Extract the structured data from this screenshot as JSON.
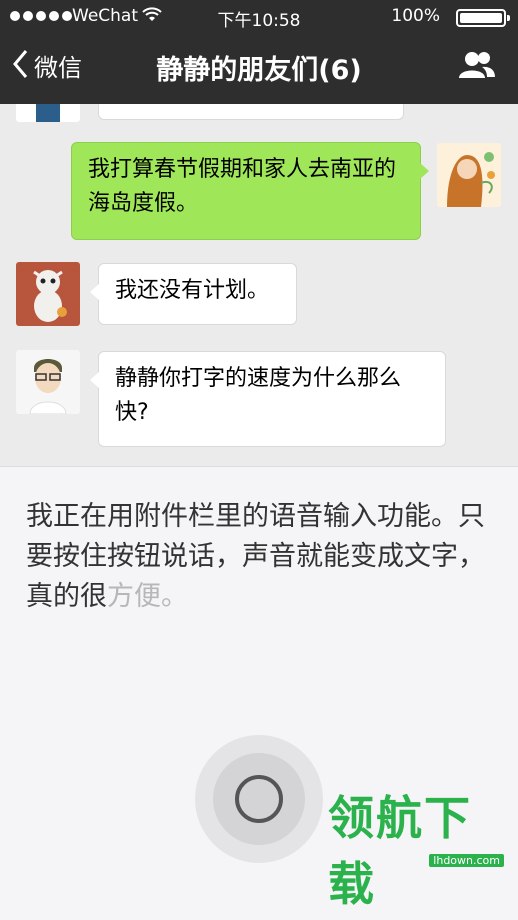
{
  "status_bar": {
    "carrier": "WeChat",
    "time": "下午10:58",
    "battery_percent": "100%",
    "battery_level": 1.0
  },
  "nav": {
    "back_label": "微信",
    "title": "静静的朋友们(6)",
    "contacts_icon": "group-icon"
  },
  "messages": [
    {
      "side": "left",
      "text": "",
      "partial": true
    },
    {
      "side": "right",
      "text": "我打算春节假期和家人去南亚的海岛度假。"
    },
    {
      "side": "left",
      "text": "我还没有计划。"
    },
    {
      "side": "left",
      "text": "静静你打字的速度为什么那么快?"
    }
  ],
  "voice_input": {
    "text_main": "我正在用附件栏里的语音输入功能。只要按住按钮说话，声音就能变成文字，真的很",
    "text_pending": "方便。",
    "button_icon": "microphone-ring-icon"
  },
  "watermark": {
    "text": "领航下载",
    "url": "lhdown.com"
  }
}
